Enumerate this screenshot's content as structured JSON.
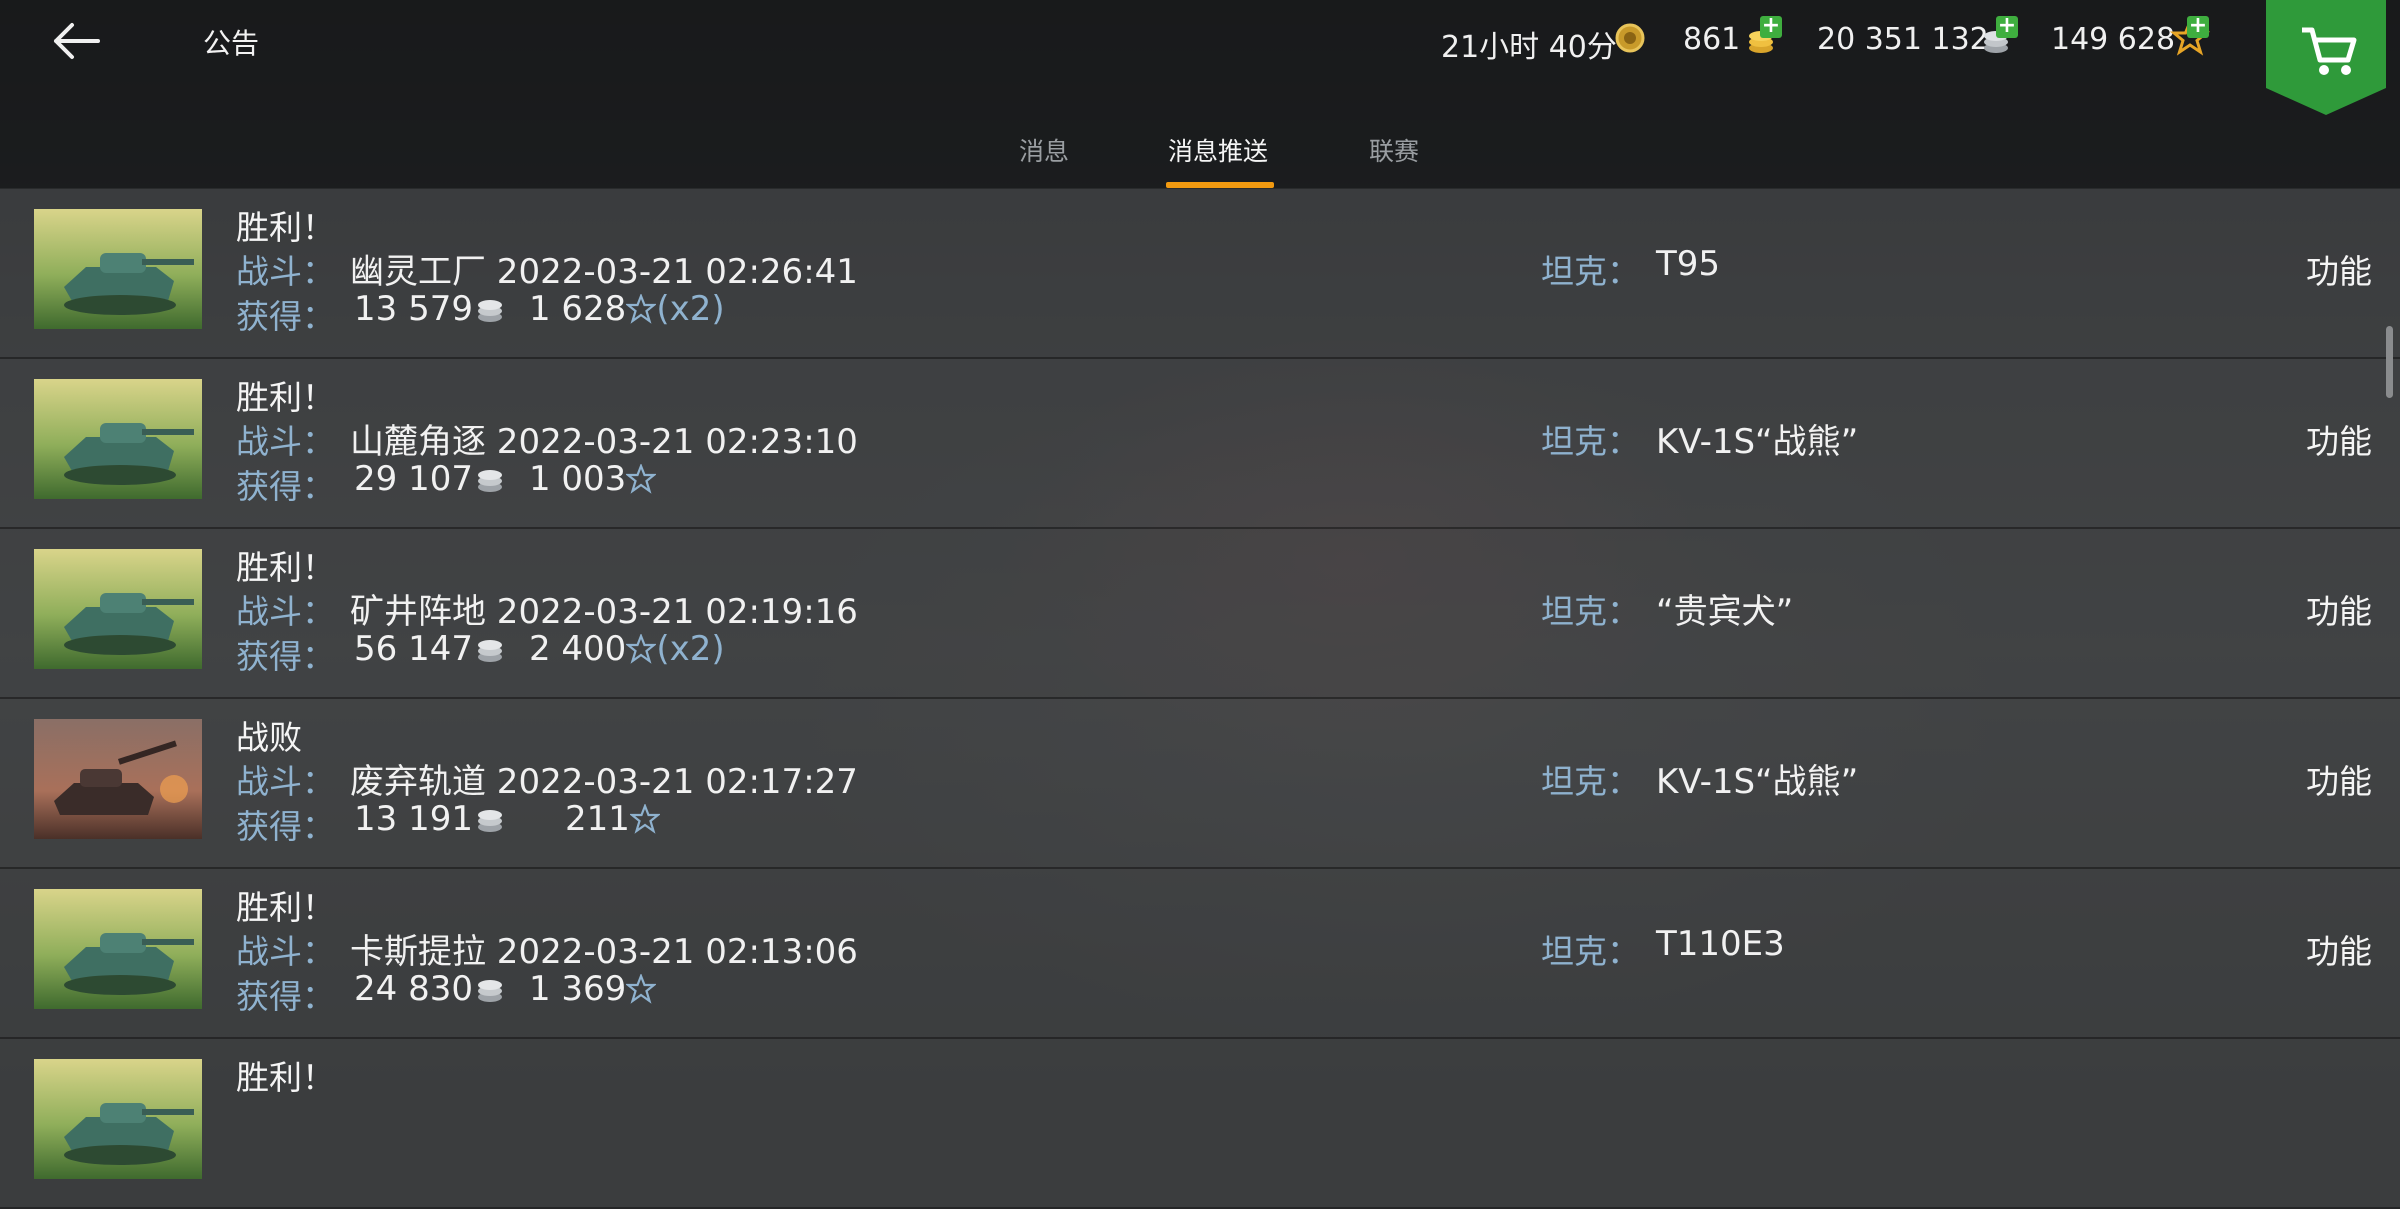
{
  "header": {
    "title": "公告",
    "timer": "21小时 40分",
    "gold": "861",
    "credits": "20 351 132",
    "free_xp": "149 628"
  },
  "tabs": [
    {
      "label": "消息",
      "active": false
    },
    {
      "label": "消息推送",
      "active": true
    },
    {
      "label": "联赛",
      "active": false
    }
  ],
  "labels": {
    "battle": "战斗：",
    "earned": "获得：",
    "tank": "坦克：",
    "function": "功能"
  },
  "messages": [
    {
      "result": "胜利！",
      "map_time": "幽灵工厂 2022-03-21 02:26:41",
      "credits": "13 579",
      "xp": "1 628",
      "mult": "(x2)",
      "tank": "T95",
      "thumb": "victory"
    },
    {
      "result": "胜利！",
      "map_time": "山麓角逐 2022-03-21 02:23:10",
      "credits": "29 107",
      "xp": "1 003",
      "mult": "",
      "tank": "KV-1S“战熊”",
      "thumb": "victory"
    },
    {
      "result": "胜利！",
      "map_time": "矿井阵地 2022-03-21 02:19:16",
      "credits": "56 147",
      "xp": "2 400",
      "mult": "(x2)",
      "tank": "“贵宾犬”",
      "thumb": "victory"
    },
    {
      "result": "战败",
      "map_time": "废弃轨道 2022-03-21 02:17:27",
      "credits": "13 191",
      "xp": "211",
      "mult": "",
      "tank": "KV-1S“战熊”",
      "thumb": "defeat"
    },
    {
      "result": "胜利！",
      "map_time": "卡斯提拉 2022-03-21 02:13:06",
      "credits": "24 830",
      "xp": "1 369",
      "mult": "",
      "tank": "T110E3",
      "thumb": "victory"
    },
    {
      "result": "胜利！",
      "map_time": "",
      "credits": "",
      "xp": "",
      "mult": "",
      "tank": "",
      "thumb": "victory"
    }
  ],
  "colors": {
    "accent": "#f29a10",
    "label": "#8fb2cf",
    "shop": "#2f9a3a"
  }
}
